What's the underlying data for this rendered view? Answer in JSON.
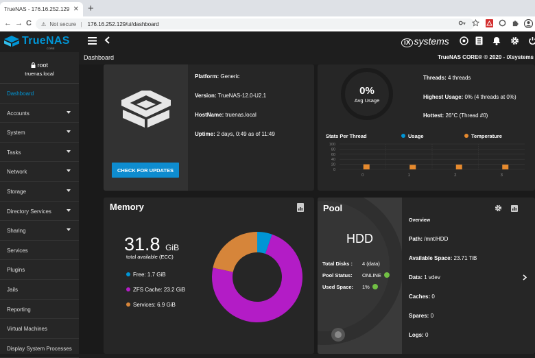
{
  "browser": {
    "tab_title": "TrueNAS - 176.16.252.129",
    "tab_close": "✕",
    "new_tab": "+",
    "back": "←",
    "forward": "→",
    "reload": "C",
    "warning_icon": "⚠",
    "not_secure": "Not secure",
    "separator": "|",
    "url": "176.16.252.129/ui/dashboard"
  },
  "header": {
    "logo_text": "TrueNAS",
    "logo_sub": "CORE",
    "ix_mark": "iX",
    "ix_text": "systems"
  },
  "sidebar": {
    "user": "root",
    "host": "truenas.local",
    "items": [
      {
        "label": "Dashboard",
        "active": true,
        "caret": false
      },
      {
        "label": "Accounts",
        "caret": true
      },
      {
        "label": "System",
        "caret": true
      },
      {
        "label": "Tasks",
        "caret": true
      },
      {
        "label": "Network",
        "caret": true
      },
      {
        "label": "Storage",
        "caret": true
      },
      {
        "label": "Directory Services",
        "caret": true
      },
      {
        "label": "Sharing",
        "caret": true
      },
      {
        "label": "Services",
        "caret": false
      },
      {
        "label": "Plugins",
        "caret": false
      },
      {
        "label": "Jails",
        "caret": false
      },
      {
        "label": "Reporting",
        "caret": false
      },
      {
        "label": "Virtual Machines",
        "caret": false
      },
      {
        "label": "Display System Processes",
        "caret": false
      }
    ]
  },
  "page": {
    "breadcrumb": "Dashboard",
    "copyright": "TrueNAS CORE® © 2020 - iXsystems"
  },
  "system_card": {
    "platform_label": "Platform:",
    "platform": "Generic",
    "version_label": "Version:",
    "version": "TrueNAS-12.0-U2.1",
    "hostname_label": "HostName:",
    "hostname": "truenas.local",
    "uptime_label": "Uptime:",
    "uptime": "2 days, 0:49 as of 11:49",
    "update_button": "CHECK FOR UPDATES"
  },
  "cpu_card": {
    "percent": "0%",
    "percent_value": 0,
    "avg_label": "Avg Usage",
    "threads_label": "Threads:",
    "threads": "4 threads",
    "highest_label": "Highest Usage:",
    "highest": "0%  (4 threads at 0%)",
    "hottest_label": "Hottest:",
    "hottest": "26°C  (Thread #0)",
    "stats_label": "Stats Per Thread",
    "usage_legend": "Usage",
    "temp_legend": "Temperature",
    "usage_color": "#0095d5",
    "temp_color": "#e68a2e"
  },
  "chart_data": {
    "type": "bar",
    "categories": [
      "0",
      "1",
      "2",
      "3"
    ],
    "series": [
      {
        "name": "Usage",
        "values": [
          0,
          0,
          0,
          0
        ]
      },
      {
        "name": "Temperature",
        "values": [
          20,
          18,
          19,
          19
        ]
      }
    ],
    "y_ticks": [
      "100",
      "80",
      "60",
      "40",
      "20",
      "0"
    ],
    "ylim": [
      0,
      100
    ]
  },
  "memory_card": {
    "title": "Memory",
    "total": "31.8",
    "unit": "GiB",
    "total_label": "total available (ECC)",
    "free_label": "Free:",
    "free": "1.7 GiB",
    "free_gib": 1.7,
    "zfs_label": "ZFS Cache:",
    "zfs": "23.2 GiB",
    "zfs_gib": 23.2,
    "services_label": "Services:",
    "services": "6.9 GiB",
    "services_gib": 6.9,
    "colors": {
      "free": "#0095d5",
      "zfs": "#b31cc6",
      "services": "#d6853a"
    }
  },
  "pool_card": {
    "title": "Pool",
    "disk_type": "HDD",
    "total_disks_label": "Total Disks :",
    "total_disks": "4 (data)",
    "status_label": "Pool Status:",
    "status": "ONLINE",
    "used_label": "Used Space:",
    "used": "1%",
    "overview": "Overview",
    "path_label": "Path:",
    "path": "/mnt/HDD",
    "avail_label": "Available Space:",
    "avail": "23.71 TiB",
    "data_label": "Data:",
    "data": "1 vdev",
    "caches_label": "Caches:",
    "caches": "0",
    "spares_label": "Spares:",
    "spares": "0",
    "logs_label": "Logs:",
    "logs": "0"
  }
}
